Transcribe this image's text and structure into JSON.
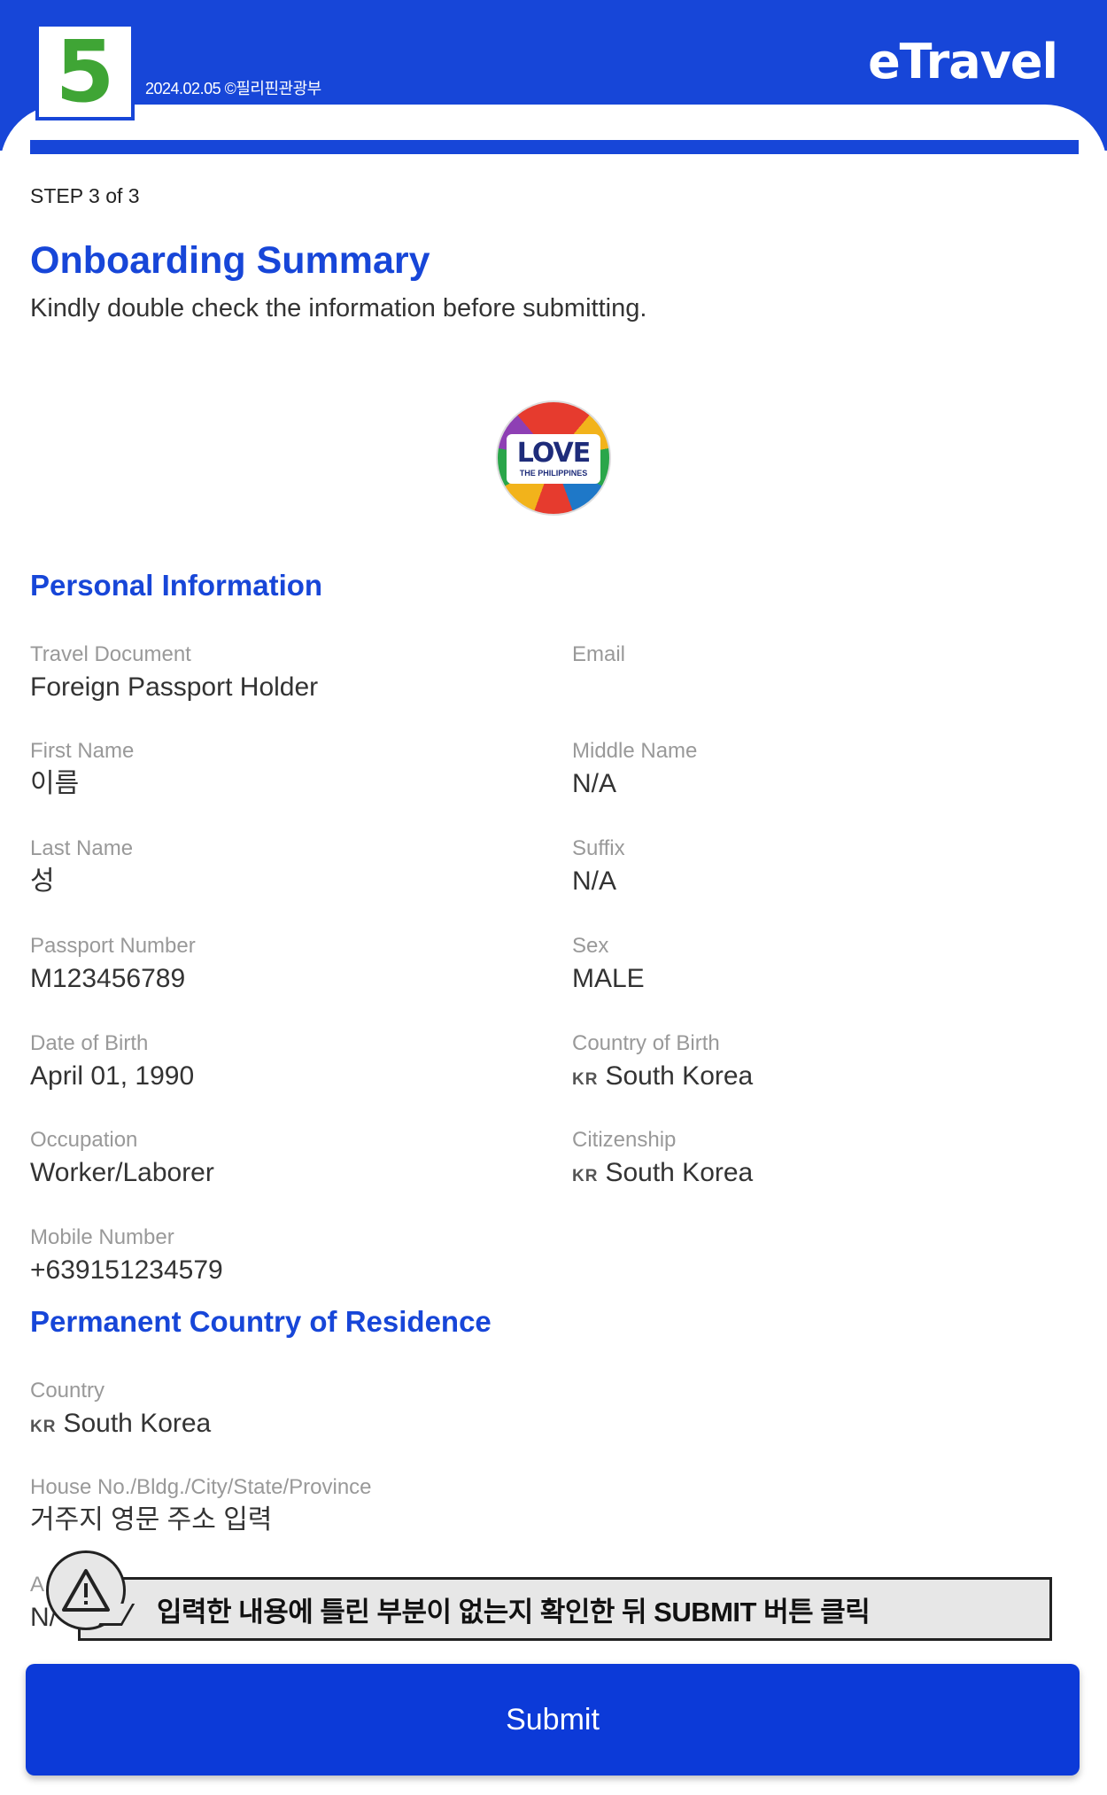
{
  "header": {
    "step_number": "5",
    "credit": "2024.02.05 ©필리핀관광부",
    "brand": "eTravel",
    "colors": {
      "primary": "#1746d8",
      "badge_number": "#3fa535"
    }
  },
  "progress": {
    "current_step": 3,
    "total_steps": 3,
    "fraction": 1.0
  },
  "page": {
    "step_label": "STEP 3 of 3",
    "title": "Onboarding Summary",
    "subtitle": "Kindly double check the information before submitting."
  },
  "logo": {
    "word": "LOVE",
    "sub": "THE PHILIPPINES"
  },
  "personal": {
    "section_title": "Personal Information",
    "travel_document": {
      "label": "Travel Document",
      "value": "Foreign Passport Holder"
    },
    "email": {
      "label": "Email",
      "value": ""
    },
    "first_name": {
      "label": "First Name",
      "value": "이름"
    },
    "middle_name": {
      "label": "Middle Name",
      "value": "N/A"
    },
    "last_name": {
      "label": "Last Name",
      "value": "성"
    },
    "suffix": {
      "label": "Suffix",
      "value": "N/A"
    },
    "passport_number": {
      "label": "Passport Number",
      "value": "M123456789"
    },
    "sex": {
      "label": "Sex",
      "value": "MALE"
    },
    "date_of_birth": {
      "label": "Date of Birth",
      "value": "April 01, 1990"
    },
    "country_of_birth": {
      "label": "Country of Birth",
      "code": "KR",
      "value": "South Korea"
    },
    "occupation": {
      "label": "Occupation",
      "value": "Worker/Laborer"
    },
    "citizenship": {
      "label": "Citizenship",
      "code": "KR",
      "value": "South Korea"
    },
    "mobile_number": {
      "label": "Mobile Number",
      "value": "+639151234579"
    }
  },
  "residence": {
    "section_title": "Permanent Country of Residence",
    "country": {
      "label": "Country",
      "code": "KR",
      "value": "South Korea"
    },
    "address": {
      "label": "House No./Bldg./City/State/Province",
      "value": "거주지 영문 주소 입력"
    },
    "partial_label": "A",
    "partial_value": "N/"
  },
  "notice": {
    "icon": "warning-icon",
    "text": "입력한 내용에 틀린 부분이 없는지 확인한 뒤 SUBMIT 버튼 클릭"
  },
  "actions": {
    "submit_label": "Submit",
    "submit_color": "#0c3ad8"
  }
}
